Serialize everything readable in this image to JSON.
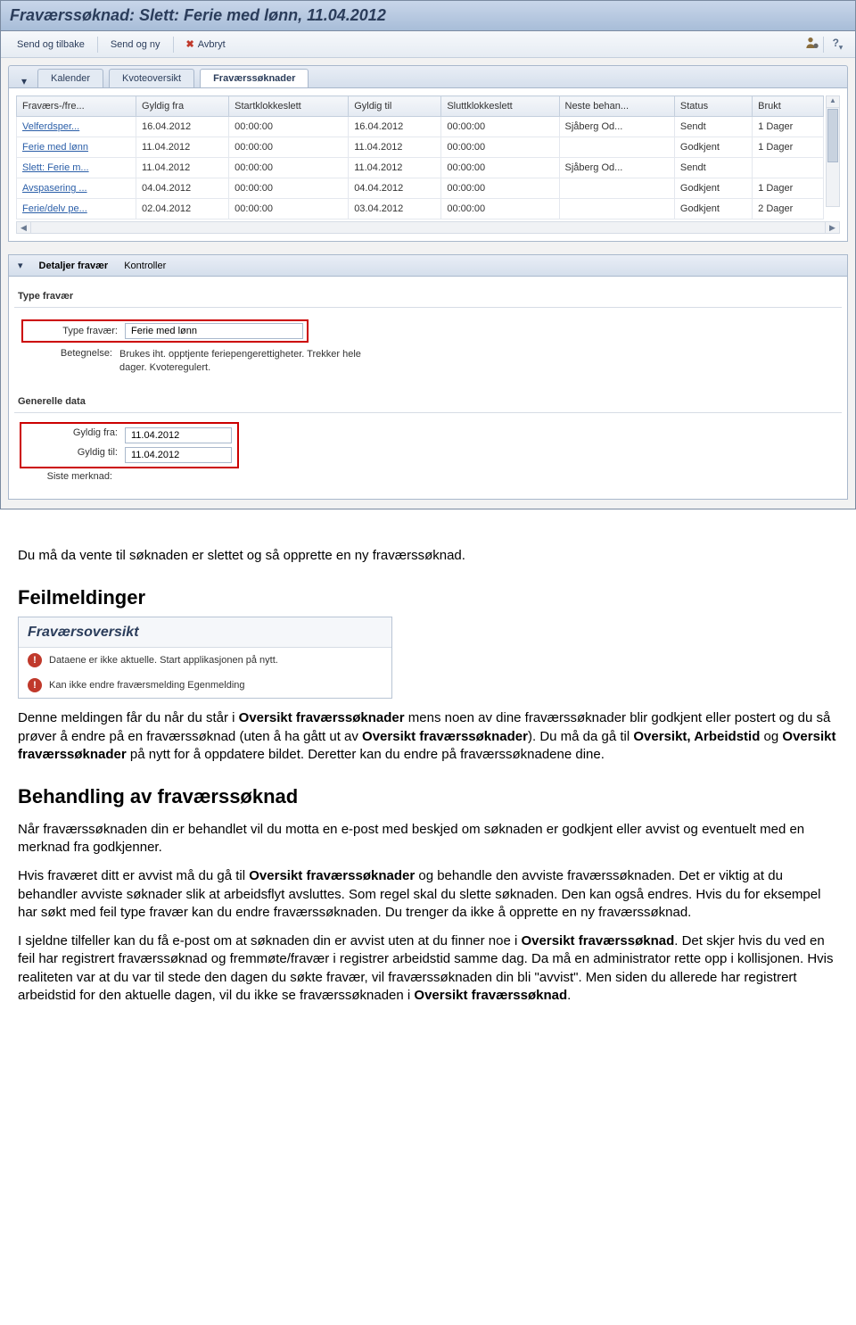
{
  "window": {
    "title": "Fraværssøknad: Slett: Ferie med lønn, 11.04.2012"
  },
  "toolbar": {
    "send_back": "Send og tilbake",
    "send_new": "Send og ny",
    "cancel": "Avbryt"
  },
  "tabs": {
    "kalender": "Kalender",
    "kvote": "Kvoteoversikt",
    "soknader": "Fraværssøknader"
  },
  "grid": {
    "headers": {
      "type": "Fraværs-/fre...",
      "from": "Gyldig fra",
      "start": "Startklokkeslett",
      "to": "Gyldig til",
      "end": "Sluttklokkeslett",
      "next": "Neste behan...",
      "status": "Status",
      "used": "Brukt"
    },
    "rows": [
      {
        "type": "Velferdsper...",
        "from": "16.04.2012",
        "start": "00:00:00",
        "to": "16.04.2012",
        "end": "00:00:00",
        "next": "Sjåberg Od...",
        "status": "Sendt",
        "used": "1 Dager"
      },
      {
        "type": "Ferie med lønn",
        "from": "11.04.2012",
        "start": "00:00:00",
        "to": "11.04.2012",
        "end": "00:00:00",
        "next": "",
        "status": "Godkjent",
        "used": "1 Dager"
      },
      {
        "type": "Slett: Ferie m...",
        "from": "11.04.2012",
        "start": "00:00:00",
        "to": "11.04.2012",
        "end": "00:00:00",
        "next": "Sjåberg Od...",
        "status": "Sendt",
        "used": ""
      },
      {
        "type": "Avspasering ...",
        "from": "04.04.2012",
        "start": "00:00:00",
        "to": "04.04.2012",
        "end": "00:00:00",
        "next": "",
        "status": "Godkjent",
        "used": "1 Dager"
      },
      {
        "type": "Ferie/delv pe...",
        "from": "02.04.2012",
        "start": "00:00:00",
        "to": "03.04.2012",
        "end": "00:00:00",
        "next": "",
        "status": "Godkjent",
        "used": "2 Dager"
      }
    ]
  },
  "details": {
    "header": "Detaljer fravær",
    "kontroller": "Kontroller",
    "group_type": "Type fravær",
    "label_type": "Type fravær:",
    "value_type": "Ferie med lønn",
    "label_betegn": "Betegnelse:",
    "value_betegn": "Brukes iht. opptjente feriepengerettigheter. Trekker hele dager. Kvoteregulert.",
    "group_general": "Generelle data",
    "label_from": "Gyldig fra:",
    "value_from": "11.04.2012",
    "label_to": "Gyldig til:",
    "value_to": "11.04.2012",
    "label_note": "Siste merknad:"
  },
  "doc": {
    "para1": "Du må da vente til søknaden er slettet og så opprette en ny fraværssøknad.",
    "h_feil": "Feilmeldinger",
    "feil_title": "Fraværsoversikt",
    "feil_msg1": "Dataene er ikke aktuelle. Start applikasjonen på nytt.",
    "feil_msg2": "Kan ikke endre fraværsmelding Egenmelding",
    "para_feil": "Denne meldingen får du når du står i Oversikt fraværssøknader mens noen av dine fraværssøknader blir godkjent eller postert og du så prøver å endre på en fraværssøknad (uten å ha gått ut av Oversikt fraværssøknader). Du må da gå til Oversikt, Arbeidstid og Oversikt fraværssøknader på nytt for å oppdatere bildet. Deretter kan du endre på fraværssøknadene dine.",
    "h_beh": "Behandling av fraværssøknad",
    "para_beh1": "Når fraværssøknaden din er behandlet vil du motta en e-post med beskjed om søknaden er godkjent eller avvist og eventuelt med en merknad fra godkjenner.",
    "para_beh2": "Hvis fraværet ditt er avvist må du gå til Oversikt fraværssøknader og behandle den avviste fraværssøknaden. Det er viktig at du behandler avviste søknader slik at arbeidsflyt avsluttes. Som regel skal du slette søknaden. Den kan også endres. Hvis du for eksempel har søkt med feil type fravær kan du endre fraværssøknaden. Du trenger da ikke å opprette en ny fraværssøknad.",
    "para_beh3": "I sjeldne tilfeller kan du få e-post om at søknaden din er avvist uten at du finner noe i Oversikt fraværssøknad. Det skjer hvis du ved en feil har registrert fraværssøknad og fremmøte/fravær i registrer arbeidstid samme dag.  Da må en administrator rette opp i kollisjonen. Hvis realiteten var at du var til stede den dagen du søkte fravær, vil fraværssøknaden din bli \"avvist\".  Men siden du allerede har registrert arbeidstid for den aktuelle dagen, vil du ikke se fraværssøknaden i Oversikt fraværssøknad."
  }
}
